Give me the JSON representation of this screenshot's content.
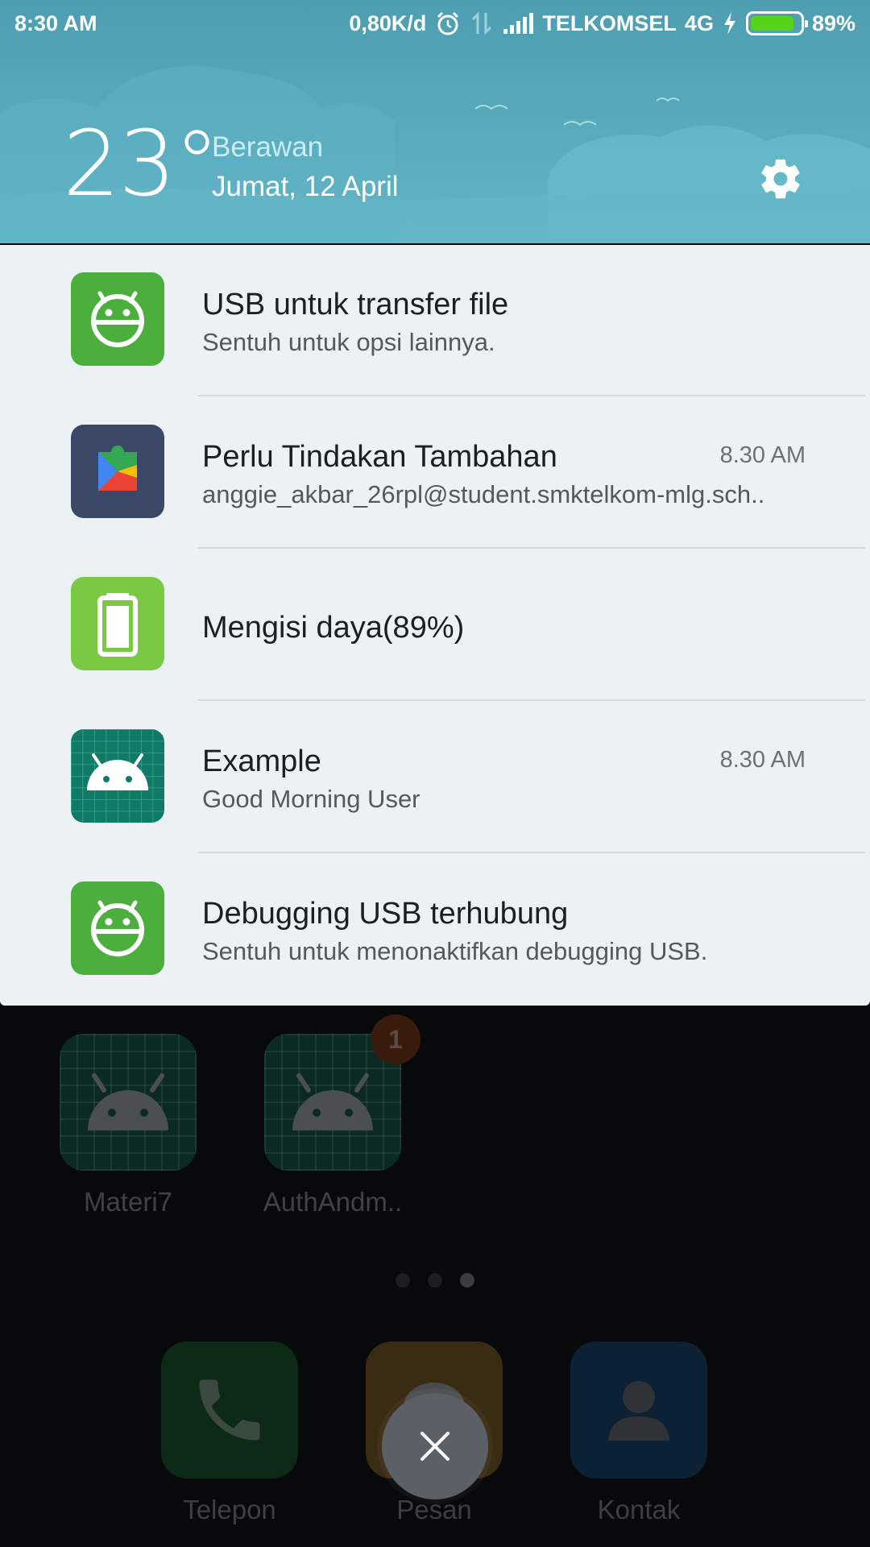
{
  "status_bar": {
    "time": "8:30 AM",
    "speed": "0,80K/d",
    "carrier": "TELKOMSEL",
    "network": "4G",
    "battery_percent": "89%",
    "battery_level": 0.89,
    "battery_color": "#55d318"
  },
  "weather": {
    "temperature": "23°",
    "condition": "Berawan",
    "date": "Jumat, 12 April",
    "settings_icon": "gear-icon"
  },
  "notifications": [
    {
      "app_icon": "android-debug-icon",
      "title": "USB untuk transfer file",
      "subtitle": "Sentuh untuk opsi lainnya.",
      "time": ""
    },
    {
      "app_icon": "google-play-services-icon",
      "title": "Perlu Tindakan Tambahan",
      "subtitle": "anggie_akbar_26rpl@student.smktelkom-mlg.sch..",
      "time": "8.30 AM"
    },
    {
      "app_icon": "battery-charging-icon",
      "title": "Mengisi daya(89%)",
      "subtitle": "",
      "time": ""
    },
    {
      "app_icon": "android-app-icon",
      "title": "Example",
      "subtitle": "Good Morning User",
      "time": "8.30 AM"
    },
    {
      "app_icon": "android-debug-icon",
      "title": "Debugging USB terhubung",
      "subtitle": "Sentuh untuk menonaktifkan debugging USB.",
      "time": ""
    }
  ],
  "home": {
    "apps": [
      {
        "label": "Materi7",
        "badge": ""
      },
      {
        "label": "AuthAndm..",
        "badge": "1"
      }
    ],
    "page_count": 3,
    "active_page": 3,
    "dock": [
      {
        "label": "Telepon",
        "icon": "phone-icon"
      },
      {
        "label": "Pesan",
        "icon": "message-icon"
      },
      {
        "label": "Kontak",
        "icon": "contact-icon"
      }
    ]
  },
  "close_button_icon": "close-icon"
}
